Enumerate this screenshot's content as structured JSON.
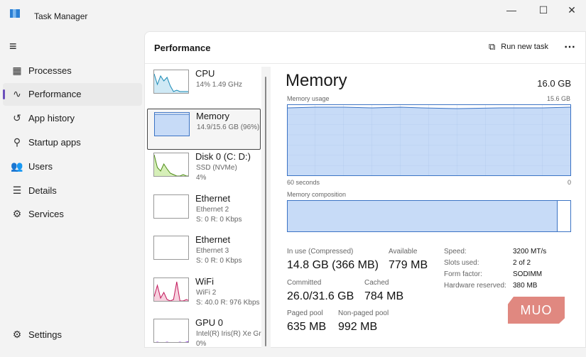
{
  "window": {
    "title": "Task Manager",
    "minimize": "—",
    "maximize": "☐",
    "close": "✕"
  },
  "nav": {
    "menu_icon": "≡",
    "items": [
      {
        "label": "Processes",
        "icon": "▦"
      },
      {
        "label": "Performance",
        "icon": "∿"
      },
      {
        "label": "App history",
        "icon": "↺"
      },
      {
        "label": "Startup apps",
        "icon": "⚲"
      },
      {
        "label": "Users",
        "icon": "👥"
      },
      {
        "label": "Details",
        "icon": "☰"
      },
      {
        "label": "Services",
        "icon": "⚙"
      }
    ],
    "settings": {
      "label": "Settings",
      "icon": "⚙"
    }
  },
  "header": {
    "title": "Performance",
    "run_new_task": "Run new task",
    "more": "⋯"
  },
  "resources": [
    {
      "name": "CPU",
      "sub1": "14% 1.49 GHz",
      "sub2": "",
      "color": "#1a8ab5",
      "fill": "#cfe9f5"
    },
    {
      "name": "Memory",
      "sub1": "14.9/15.6 GB (96%)",
      "sub2": "",
      "color": "#3b73c4",
      "fill": "#c7dbf7"
    },
    {
      "name": "Disk 0 (C: D:)",
      "sub1": "SSD (NVMe)",
      "sub2": "4%",
      "color": "#4d8a16",
      "fill": "#d6efb8"
    },
    {
      "name": "Ethernet",
      "sub1": "Ethernet 2",
      "sub2": "S: 0 R: 0 Kbps",
      "color": "#999",
      "fill": "#fff"
    },
    {
      "name": "Ethernet",
      "sub1": "Ethernet 3",
      "sub2": "S: 0 R: 0 Kbps",
      "color": "#999",
      "fill": "#fff"
    },
    {
      "name": "WiFi",
      "sub1": "WiFi 2",
      "sub2": "S: 40.0 R: 976 Kbps",
      "color": "#c2185b",
      "fill": "#f7d0de"
    },
    {
      "name": "GPU 0",
      "sub1": "Intel(R) Iris(R) Xe Graphics",
      "sub2": "0%",
      "color": "#8a2be2",
      "fill": "#fff"
    }
  ],
  "detail": {
    "title": "Memory",
    "total": "16.0 GB",
    "usage_label": "Memory usage",
    "usage_max": "15.6 GB",
    "time_left": "60 seconds",
    "time_right": "0",
    "composition_label": "Memory composition",
    "in_use_fraction": 0.955,
    "stats": [
      {
        "label": "In use (Compressed)",
        "value": "14.8 GB (366 MB)"
      },
      {
        "label": "Available",
        "value": "779 MB"
      },
      {
        "label": "Committed",
        "value": "26.0/31.6 GB"
      },
      {
        "label": "Cached",
        "value": "784 MB"
      },
      {
        "label": "Paged pool",
        "value": "635 MB"
      },
      {
        "label": "Non-paged pool",
        "value": "992 MB"
      }
    ],
    "specs": [
      {
        "label": "Speed:",
        "value": "3200 MT/s"
      },
      {
        "label": "Slots used:",
        "value": "2 of 2"
      },
      {
        "label": "Form factor:",
        "value": "SODIMM"
      },
      {
        "label": "Hardware reserved:",
        "value": "380 MB"
      }
    ]
  },
  "watermark": "MUO"
}
